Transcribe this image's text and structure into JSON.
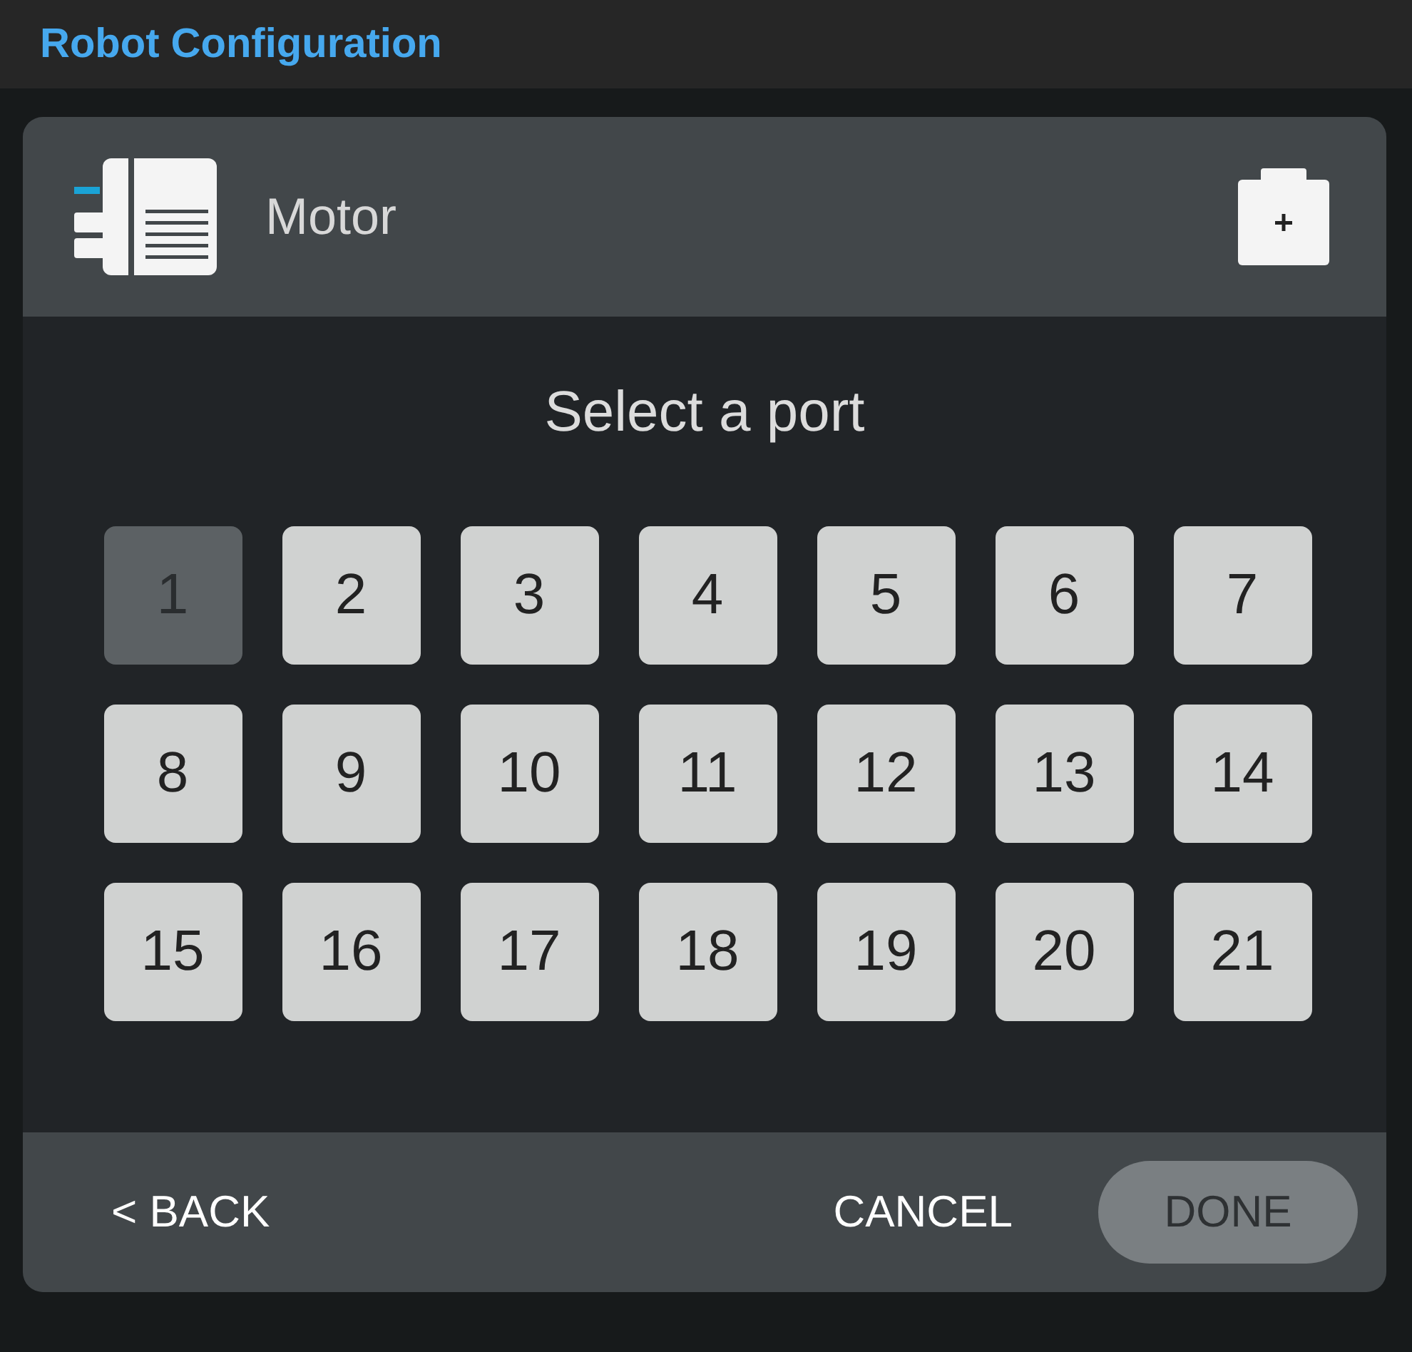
{
  "app_bar": {
    "title": "Robot Configuration"
  },
  "device": {
    "name": "Motor"
  },
  "prompt": "Select a port",
  "ports": [
    {
      "label": "1",
      "disabled": true
    },
    {
      "label": "2",
      "disabled": false
    },
    {
      "label": "3",
      "disabled": false
    },
    {
      "label": "4",
      "disabled": false
    },
    {
      "label": "5",
      "disabled": false
    },
    {
      "label": "6",
      "disabled": false
    },
    {
      "label": "7",
      "disabled": false
    },
    {
      "label": "8",
      "disabled": false
    },
    {
      "label": "9",
      "disabled": false
    },
    {
      "label": "10",
      "disabled": false
    },
    {
      "label": "11",
      "disabled": false
    },
    {
      "label": "12",
      "disabled": false
    },
    {
      "label": "13",
      "disabled": false
    },
    {
      "label": "14",
      "disabled": false
    },
    {
      "label": "15",
      "disabled": false
    },
    {
      "label": "16",
      "disabled": false
    },
    {
      "label": "17",
      "disabled": false
    },
    {
      "label": "18",
      "disabled": false
    },
    {
      "label": "19",
      "disabled": false
    },
    {
      "label": "20",
      "disabled": false
    },
    {
      "label": "21",
      "disabled": false
    }
  ],
  "footer": {
    "back": "< BACK",
    "cancel": "CANCEL",
    "done": {
      "label": "DONE",
      "disabled": true
    }
  }
}
